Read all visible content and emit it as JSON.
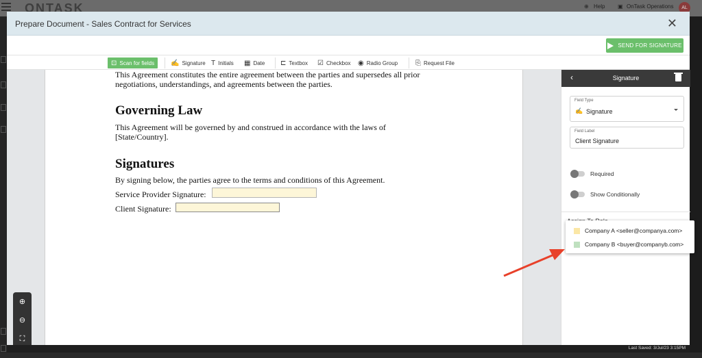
{
  "background_app": {
    "logo": "ONTASK",
    "help": "Help",
    "org": "OnTask Operations",
    "avatar": "AL"
  },
  "modal": {
    "title": "Prepare Document - Sales Contract for Services",
    "send_button": "SEND FOR SIGNATURE"
  },
  "toolbar": {
    "items": [
      {
        "label": "Scan for fields",
        "icon": "scan-icon"
      },
      {
        "label": "Signature",
        "icon": "signature-icon"
      },
      {
        "label": "Initials",
        "icon": "initials-icon"
      },
      {
        "label": "Date",
        "icon": "calendar-icon"
      },
      {
        "label": "Textbox",
        "icon": "textbox-icon"
      },
      {
        "label": "Checkbox",
        "icon": "checkbox-icon"
      },
      {
        "label": "Radio Group",
        "icon": "radio-icon"
      },
      {
        "label": "Request File",
        "icon": "file-request-icon"
      }
    ]
  },
  "document": {
    "intro_line1": "This Agreement constitutes the entire agreement between the parties and supersedes all prior",
    "intro_line2": "negotiations, understandings, and agreements between the parties.",
    "heading_governing": "Governing Law",
    "governing_line1": "This Agreement will be governed by and construed in accordance with the laws of",
    "governing_line2": "[State/Country].",
    "heading_signatures": "Signatures",
    "signatures_intro": "By signing below, the parties agree to the terms and conditions of this Agreement.",
    "provider_label": "Service Provider Signature:",
    "client_label": "Client Signature:"
  },
  "panel": {
    "title": "Signature",
    "field_type_label": "Field Type",
    "field_type_value": "Signature",
    "field_label_label": "Field Label",
    "field_label_value": "Client Signature",
    "required_label": "Required",
    "show_conditionally_label": "Show Conditionally",
    "assign_label": "Assign To Role"
  },
  "roles": [
    {
      "label": "Company A <seller@companya.com>",
      "color": "#fbe7a6"
    },
    {
      "label": "Company B <buyer@companyb.com>",
      "color": "#bfe0bf"
    }
  ],
  "footer": {
    "last_saved": "Last Saved: 3/Jul/23 3:15PM"
  },
  "colors": {
    "accent_green": "#6bbf6b",
    "annotation_arrow": "#e8412a"
  }
}
